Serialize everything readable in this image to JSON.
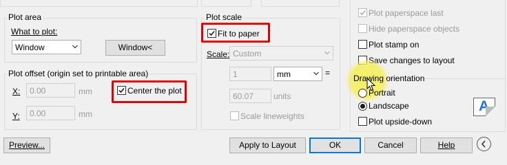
{
  "plot_area": {
    "title": "Plot area",
    "what_to_plot_label": "What to plot:",
    "what_to_plot_value": "Window",
    "window_button": "Window<"
  },
  "plot_offset": {
    "title": "Plot offset (origin set to printable area)",
    "x_label": "X:",
    "x_value": "0.00",
    "x_unit": "mm",
    "y_label": "Y:",
    "y_value": "0.00",
    "y_unit": "mm",
    "center_label": "Center the plot"
  },
  "plot_scale": {
    "title": "Plot scale",
    "fit_label": "Fit to paper",
    "scale_label": "Scale:",
    "scale_value": "Custom",
    "value1": "1",
    "unit1": "mm",
    "equals": "=",
    "value2": "60.07",
    "unit2": "units",
    "lineweights_label": "Scale lineweights"
  },
  "options": {
    "plot_paperspace_last": "Plot paperspace last",
    "hide_paperspace_objects": "Hide paperspace objects",
    "plot_stamp_on": "Plot stamp on",
    "save_changes": "Save changes to layout"
  },
  "orientation": {
    "title": "Drawing orientation",
    "portrait": "Portrait",
    "landscape": "Landscape",
    "upside_down": "Plot upside-down",
    "icon_letter": "A"
  },
  "buttons": {
    "preview": "Preview...",
    "apply": "Apply to Layout",
    "ok": "OK",
    "cancel": "Cancel",
    "help": "Help"
  },
  "colors": {
    "highlight": "#e00000",
    "accent": "#0078d7",
    "cursor_halo": "#f5ef5a"
  }
}
